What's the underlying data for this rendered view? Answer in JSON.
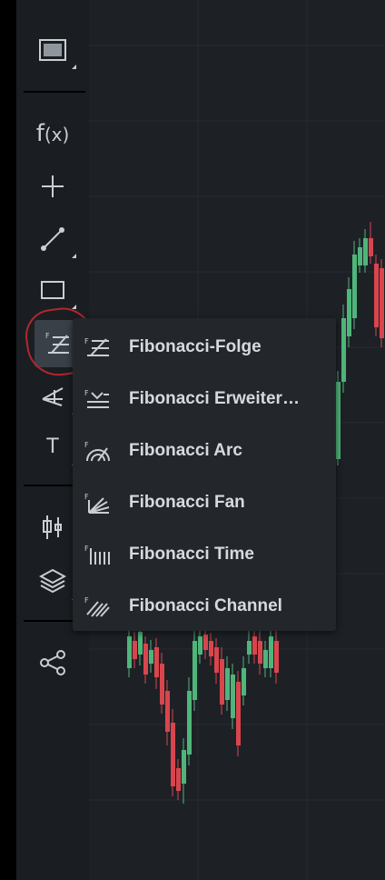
{
  "toolbar": {
    "items": [
      {
        "id": "screen",
        "icon": "screen-icon"
      },
      {
        "id": "functions",
        "icon": "function-icon",
        "label": "f",
        "label_paren": "(x)"
      },
      {
        "id": "crosshair",
        "icon": "crosshair-icon"
      },
      {
        "id": "trend-line",
        "icon": "trend-line-icon"
      },
      {
        "id": "rectangle",
        "icon": "rectangle-icon"
      },
      {
        "id": "fibonacci",
        "icon": "fibonacci-icon",
        "active": true
      },
      {
        "id": "pitchfork",
        "icon": "pitchfork-icon"
      },
      {
        "id": "text",
        "icon": "text-icon",
        "label": "T"
      },
      {
        "id": "candles",
        "icon": "candlestick-icon"
      },
      {
        "id": "layers",
        "icon": "layers-icon"
      },
      {
        "id": "share",
        "icon": "share-icon"
      }
    ]
  },
  "fib_menu": {
    "items": [
      {
        "label": "Fibonacci-Folge",
        "icon": "fibonacci-retracement-icon"
      },
      {
        "label": "Fibonacci Erweiter…",
        "icon": "fibonacci-extension-icon"
      },
      {
        "label": "Fibonacci Arc",
        "icon": "fibonacci-arc-icon"
      },
      {
        "label": "Fibonacci Fan",
        "icon": "fibonacci-fan-icon"
      },
      {
        "label": "Fibonacci Time",
        "icon": "fibonacci-time-icon"
      },
      {
        "label": "Fibonacci Channel",
        "icon": "fibonacci-channel-icon"
      }
    ]
  },
  "colors": {
    "up_candle": "#4fb57a",
    "down_candle": "#d9454d",
    "highlight": "#b3262e",
    "icon": "#c9ced4"
  }
}
